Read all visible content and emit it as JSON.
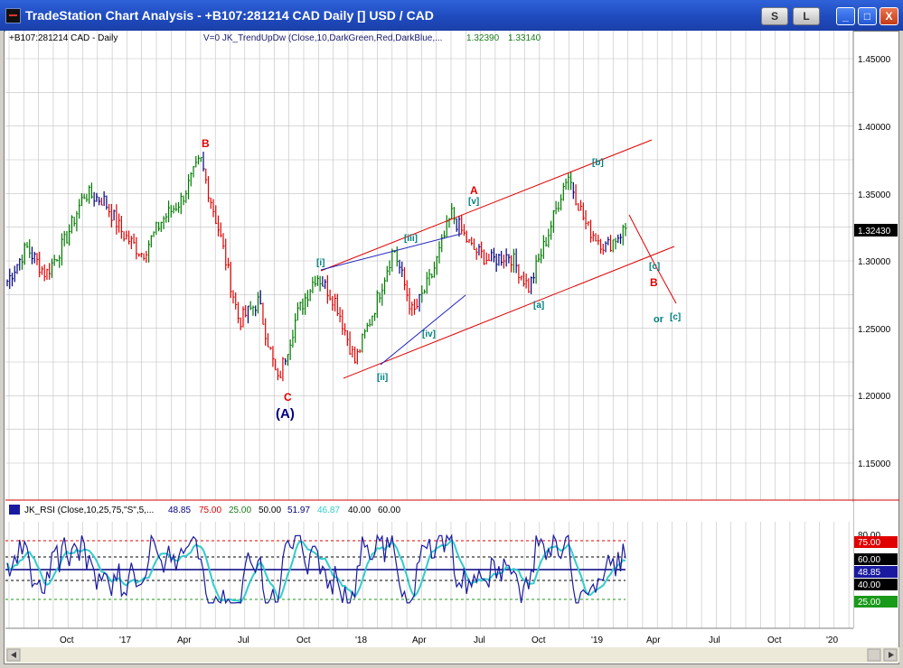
{
  "window": {
    "title": "TradeStation Chart Analysis  - +B107:281214 CAD Daily [] USD / CAD",
    "btn_s": "S",
    "btn_l": "L",
    "btn_minimize": "_",
    "btn_maximize": "□",
    "btn_close": "X"
  },
  "price_panel": {
    "symbol_label": "+B107:281214 CAD - Daily",
    "indicator_label": "V=0  JK_TrendUpDw (Close,10,DarkGreen,Red,DarkBlue,...",
    "indicator_val1": "1.32390",
    "indicator_val2": "1.33140",
    "last_price": "1.32430",
    "y_ticks": [
      "1.45000",
      "1.40000",
      "1.35000",
      "1.30000",
      "1.25000",
      "1.20000",
      "1.15000"
    ]
  },
  "wave_labels": {
    "B_top": "B",
    "C_bottom": "C",
    "A_major": "(A)",
    "A_minor": "A",
    "wave_i": "[i]",
    "wave_ii": "[ii]",
    "wave_iii": "[iii]",
    "wave_iv": "[iv]",
    "wave_v": "[v]",
    "wave_a": "[a]",
    "wave_b": "[b]",
    "wave_c1": "[c]",
    "B_right": "B",
    "or_text": "or",
    "wave_c2": "[c]"
  },
  "rsi_panel": {
    "label": "JK_RSI (Close,10,25,75,\"S\",5,...",
    "v1": "48.85",
    "v2": "75.00",
    "v3": "25.00",
    "v4": "50.00",
    "v5": "51.97",
    "v6": "46.87",
    "v7": "40.00",
    "v8": "60.00",
    "axis_80": "80.00",
    "box_75": "75.00",
    "box_60": "60.00",
    "box_4885": "48.85",
    "box_40": "40.00",
    "box_25": "25.00"
  },
  "x_axis": [
    "Oct",
    "'17",
    "Apr",
    "Jul",
    "Oct",
    "'18",
    "Apr",
    "Jul",
    "Oct",
    "'19",
    "Apr",
    "Jul",
    "Oct",
    "'20"
  ],
  "colors": {
    "up_bar": "#007a00",
    "down_bar": "#e00000",
    "neutral_bar": "#000080",
    "channel": "#e00000",
    "trendline": "#2020c0",
    "wave_teal": "#008080",
    "wave_red": "#e00000",
    "wave_navy": "#000080",
    "grid": "#c0c0c0"
  },
  "chart_data": {
    "type": "ohlc-bar",
    "symbol": "USD / CAD",
    "interval": "Daily",
    "y_range": [
      1.12,
      1.47
    ],
    "y_ticks": [
      1.15,
      1.2,
      1.25,
      1.3,
      1.35,
      1.4,
      1.45
    ],
    "x_labels": [
      "Oct",
      "'17",
      "Apr",
      "Jul",
      "Oct",
      "'18",
      "Apr",
      "Jul",
      "Oct",
      "'19",
      "Apr",
      "Jul",
      "Oct",
      "'20"
    ],
    "approx_close_path": [
      {
        "t": "Jul '16",
        "v": 1.285
      },
      {
        "t": "Aug '16",
        "v": 1.31
      },
      {
        "t": "Sep '16",
        "v": 1.29
      },
      {
        "t": "Oct '16",
        "v": 1.315
      },
      {
        "t": "Nov '16",
        "v": 1.35
      },
      {
        "t": "Dec '16",
        "v": 1.345
      },
      {
        "t": "Jan '17",
        "v": 1.32
      },
      {
        "t": "Feb '17",
        "v": 1.305
      },
      {
        "t": "Mar '17",
        "v": 1.33
      },
      {
        "t": "Apr '17",
        "v": 1.345
      },
      {
        "t": "May '17",
        "v": 1.375
      },
      {
        "t": "Jun '17",
        "v": 1.32
      },
      {
        "t": "Jul '17",
        "v": 1.255
      },
      {
        "t": "Aug '17",
        "v": 1.27
      },
      {
        "t": "Sep '17",
        "v": 1.21
      },
      {
        "t": "Oct '17",
        "v": 1.26
      },
      {
        "t": "Nov '17",
        "v": 1.29
      },
      {
        "t": "Dec '17",
        "v": 1.27
      },
      {
        "t": "Jan '18",
        "v": 1.225
      },
      {
        "t": "Feb '18",
        "v": 1.265
      },
      {
        "t": "Mar '18",
        "v": 1.31
      },
      {
        "t": "Apr '18",
        "v": 1.26
      },
      {
        "t": "May '18",
        "v": 1.29
      },
      {
        "t": "Jun '18",
        "v": 1.335
      },
      {
        "t": "Jul '18",
        "v": 1.31
      },
      {
        "t": "Aug '18",
        "v": 1.3
      },
      {
        "t": "Sep '18",
        "v": 1.305
      },
      {
        "t": "Oct '18",
        "v": 1.28
      },
      {
        "t": "Nov '18",
        "v": 1.32
      },
      {
        "t": "Dec '18",
        "v": 1.365
      },
      {
        "t": "Jan '19",
        "v": 1.325
      },
      {
        "t": "Feb '19",
        "v": 1.31
      },
      {
        "t": "Mar '19",
        "v": 1.3243
      }
    ],
    "last": 1.3243,
    "rsi": {
      "range": [
        20,
        80
      ],
      "levels": [
        25,
        40,
        50,
        60,
        75
      ],
      "last": 48.85
    }
  }
}
